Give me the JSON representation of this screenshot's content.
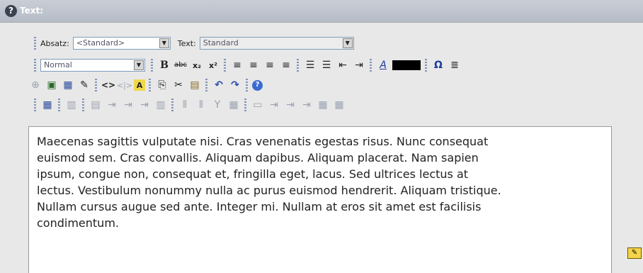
{
  "header": {
    "title": "Text:"
  },
  "toolbar1": {
    "paragraph_label": "Absatz:",
    "paragraph_value": "<Standard>",
    "text_label": "Text:",
    "text_value": "Standard"
  },
  "toolbar2": {
    "format_value": "Normal",
    "bold": "B",
    "strike": "abc",
    "sub": "x₂",
    "sup": "x²",
    "align_left": "≡",
    "align_center": "≡",
    "align_right": "≡",
    "align_justify": "≡",
    "ordered_list": "☰",
    "unordered_list": "☰",
    "outdent": "⇤",
    "indent": "⇥",
    "text_color": "A",
    "special_char": "Ω",
    "hr": "≣",
    "color_hex": "#000000"
  },
  "toolbar3": {
    "link": "⊕",
    "image": "▣",
    "table": "▦",
    "insert": "✎",
    "source": "<>",
    "source_dim": "<|>",
    "find": "A",
    "copy": "⎘",
    "cut": "✂",
    "paste": "▤",
    "undo": "↶",
    "redo": "↷",
    "help": "?"
  },
  "toolbar4": {
    "table_props": "▦",
    "cell": "▥",
    "row_props": "▤",
    "row_before": "⇥",
    "row_after": "⇥",
    "row_delete": "⇥",
    "col_props": "▥",
    "merge1": "⫴",
    "merge2": "⫴",
    "split": "Y",
    "col": "▦",
    "cell1": "▭",
    "cell2": "⇥",
    "cell3": "⇥",
    "cell4": "⇥",
    "cell5": "▦",
    "cell6": "▦"
  },
  "editor": {
    "lines": [
      "Maecenas sagittis vulputate nisi. Cras venenatis egestas risus. Nunc consequat",
      "euismod sem. Cras convallis. Aliquam dapibus. Aliquam placerat. Nam sapien",
      "ipsum, congue non, consequat et, fringilla eget, lacus. Sed ultrices lectus at",
      "lectus. Vestibulum nonummy nulla ac purus euismod hendrerit. Aliquam tristique.",
      "Nullam cursus augue sed ante. Integer mi. Nullam at eros sit amet est facilisis",
      "condimentum."
    ]
  }
}
